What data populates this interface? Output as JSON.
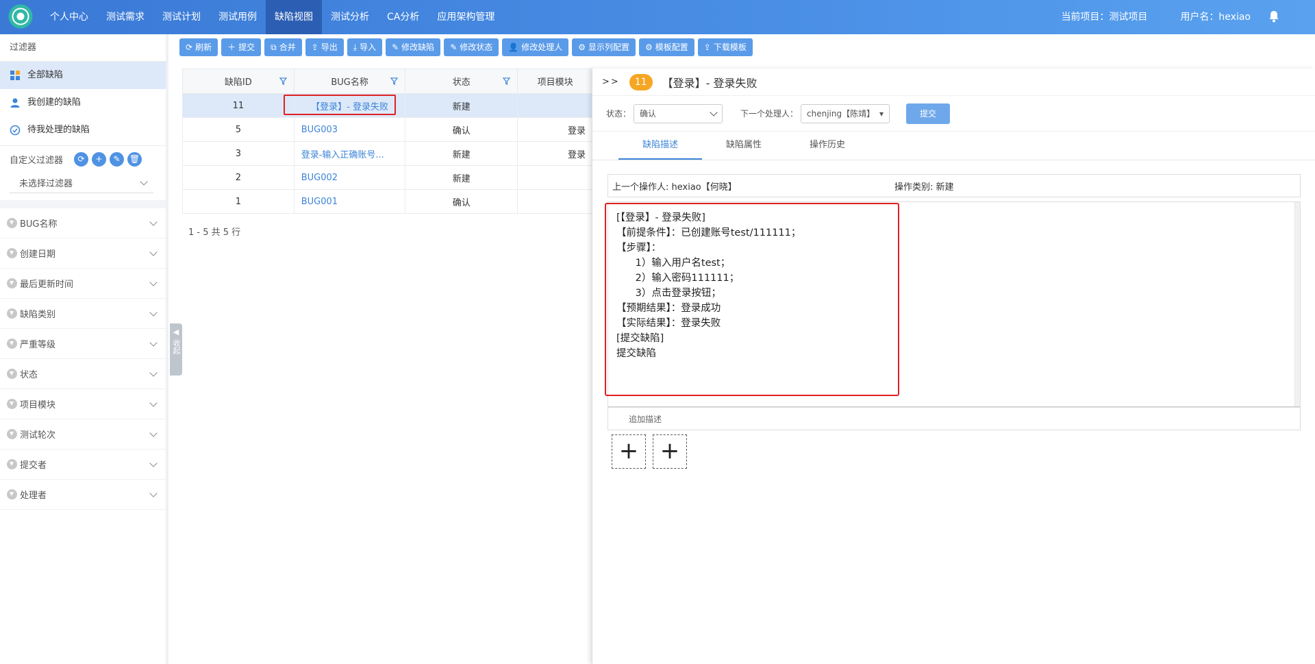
{
  "nav": {
    "items": [
      "个人中心",
      "测试需求",
      "测试计划",
      "测试用例",
      "缺陷视图",
      "测试分析",
      "CA分析",
      "应用架构管理"
    ],
    "current_project": "当前项目：测试项目",
    "username": "用户名：hexiao"
  },
  "sidebar": {
    "title": "过滤器",
    "items": [
      "全部缺陷",
      "我创建的缺陷",
      "待我处理的缺陷"
    ],
    "custom_label": "自定义过滤器",
    "select_placeholder": "未选择过滤器",
    "accordions": [
      "BUG名称",
      "创建日期",
      "最后更新时间",
      "缺陷类别",
      "严重等级",
      "状态",
      "项目模块",
      "测试轮次",
      "提交者",
      "处理者"
    ],
    "collapse_label": "收起"
  },
  "toolbar": [
    "刷新",
    "提交",
    "合并",
    "导出",
    "导入",
    "修改缺陷",
    "修改状态",
    "修改处理人",
    "显示列配置",
    "模板配置",
    "下载模板"
  ],
  "table": {
    "headers": [
      "缺陷ID",
      "BUG名称",
      "状态",
      "项目模块"
    ],
    "rows": [
      {
        "id": "11",
        "name": "【登录】- 登录失败",
        "status": "新建",
        "module": ""
      },
      {
        "id": "5",
        "name": "BUG003",
        "status": "确认",
        "module": "登录"
      },
      {
        "id": "3",
        "name": "登录-输入正确账号...",
        "status": "新建",
        "module": "登录"
      },
      {
        "id": "2",
        "name": "BUG002",
        "status": "新建",
        "module": ""
      },
      {
        "id": "1",
        "name": "BUG001",
        "status": "确认",
        "module": ""
      }
    ],
    "pager": "1 - 5 共 5 行"
  },
  "panel": {
    "arrows": ">>",
    "badge": "11",
    "title": "【登录】- 登录失败",
    "status_label": "状态：",
    "status_value": "确认",
    "next_handler_label": "下一个处理人：",
    "next_handler_value": "chenjing【陈靖】",
    "submit": "提交",
    "tabs": [
      "缺陷描述",
      "缺陷属性",
      "操作历史"
    ],
    "prev_operator": "上一个操作人: hexiao【何晓】",
    "op_type": "操作类别: 新建",
    "description": "[【登录】- 登录失败]\n【前提条件】：已创建账号test/111111；\n【步骤】：\n      1）输入用户名test；\n      2）输入密码111111；\n      3）点击登录按钮；\n【预期结果】：登录成功\n【实际结果】：登录失败\n[提交缺陷]\n提交缺陷",
    "append_label": "追加描述"
  }
}
